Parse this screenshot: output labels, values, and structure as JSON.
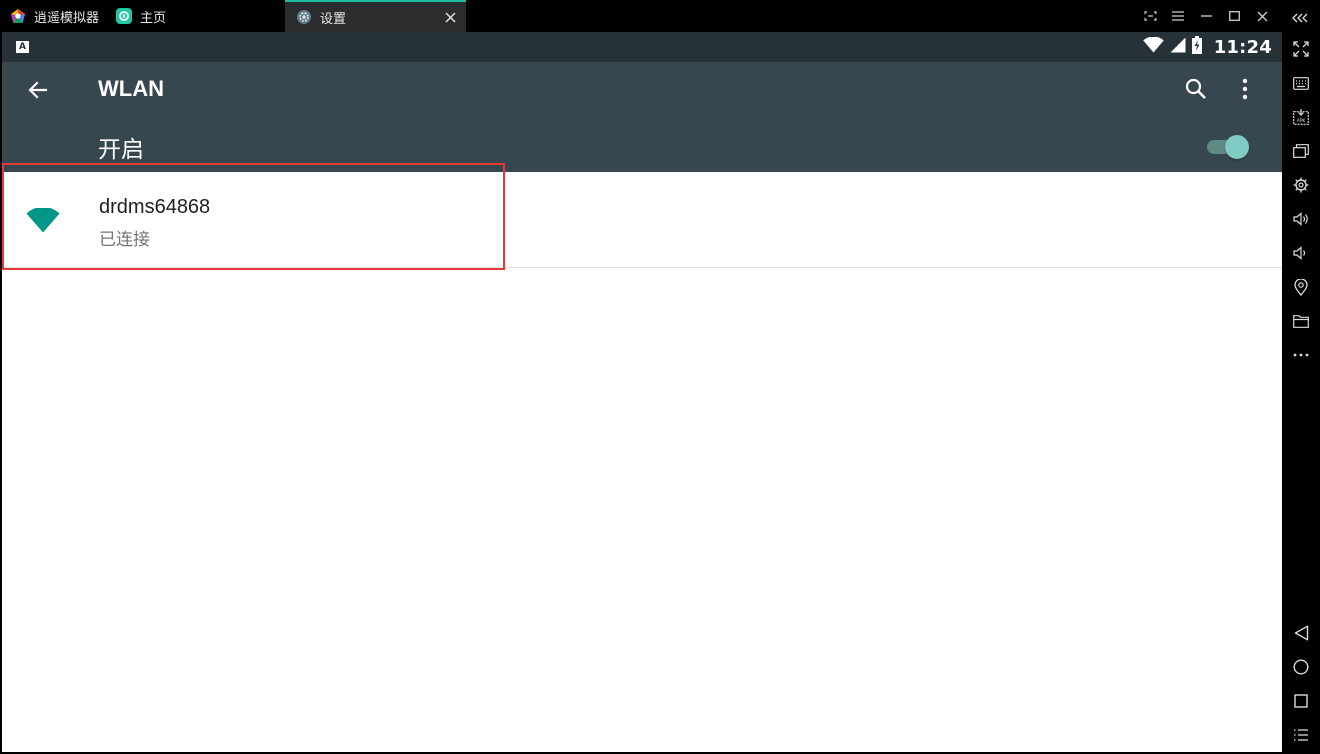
{
  "emulator": {
    "app_tab_label": "逍遥模拟器",
    "tabs": [
      {
        "label": "主页"
      },
      {
        "label": "设置"
      }
    ],
    "sidebar_tools": [
      "fullscreen-icon",
      "keyboard-icon",
      "apk-install-icon",
      "multi-window-icon",
      "settings-icon",
      "volume-up-icon",
      "volume-down-icon",
      "location-icon",
      "folder-icon",
      "more-icon",
      "nav-back-icon",
      "nav-home-icon",
      "nav-recents-icon",
      "menu-list-icon"
    ]
  },
  "status_bar": {
    "notification_letter": "A",
    "time": "11:24"
  },
  "app_bar": {
    "title": "WLAN"
  },
  "wlan_switch": {
    "label": "开启",
    "on": true
  },
  "networks": [
    {
      "ssid": "drdms64868",
      "status": "已连接"
    }
  ],
  "colors": {
    "app_bar": "#37474f",
    "status_bar": "#263238",
    "accent": "#009688",
    "toggle_thumb": "#80cbc4",
    "highlight": "#e53935",
    "active_tab_indicator": "#1bbf9f"
  }
}
